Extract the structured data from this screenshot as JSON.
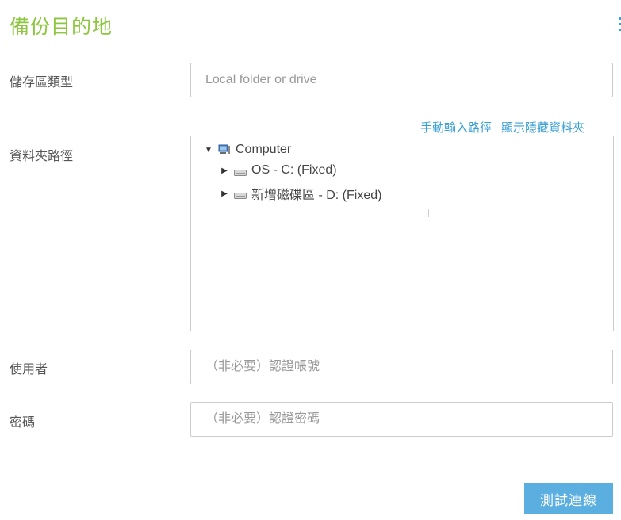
{
  "page": {
    "title": "備份目的地"
  },
  "form": {
    "storage_type": {
      "label": "儲存區類型",
      "placeholder": "Local folder or drive"
    },
    "folder_path": {
      "label": "資料夾路徑",
      "links": {
        "manual_input": "手動輸入路徑",
        "show_hidden": "顯示隱藏資料夾"
      },
      "tree": {
        "root": {
          "label": "Computer",
          "expanded": true,
          "icon": "computer-icon"
        },
        "children": [
          {
            "label": "OS - C: (Fixed)",
            "expanded": false,
            "icon": "drive-icon"
          },
          {
            "label": "新增磁碟區 - D: (Fixed)",
            "expanded": false,
            "icon": "drive-icon"
          }
        ]
      }
    },
    "username": {
      "label": "使用者",
      "placeholder": "（非必要）認證帳號"
    },
    "password": {
      "label": "密碼",
      "placeholder": "（非必要）認證密碼"
    }
  },
  "actions": {
    "test_connection": "測試連線"
  },
  "colors": {
    "title": "#8dc63f",
    "link": "#3a9fd6",
    "button": "#5aaee0",
    "border": "#cccccc"
  }
}
